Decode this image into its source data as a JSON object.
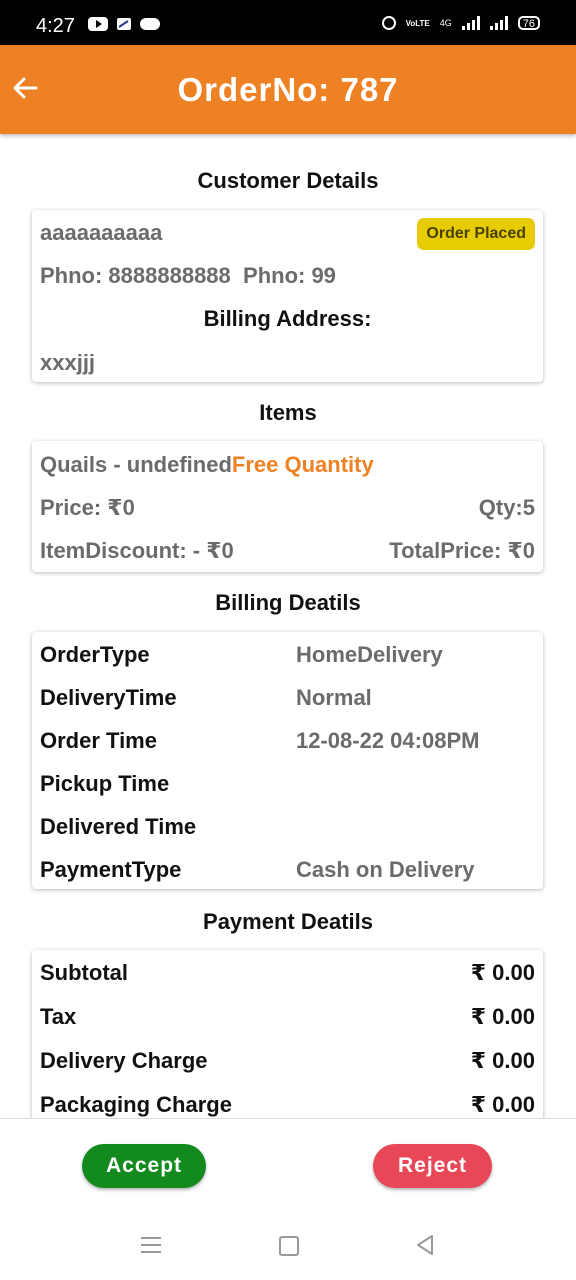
{
  "status_bar": {
    "time": "4:27",
    "battery": "76",
    "network": "4G",
    "volte": "VoLTE"
  },
  "app_bar": {
    "title": "OrderNo: 787"
  },
  "customer": {
    "section_title": "Customer Details",
    "name": "aaaaaaaaaa",
    "status": "Order Placed",
    "phone1": "Phno: 8888888888",
    "phone2": "Phno: 99",
    "billing_label": "Billing Address:",
    "address": "xxxjjj"
  },
  "items": {
    "section_title": "Items",
    "list": [
      {
        "name": "Quails - undefined",
        "tag": "Free Quantity",
        "price": "Price: ₹0",
        "qty": "Qty:5",
        "discount": "ItemDiscount: - ₹0",
        "total": "TotalPrice: ₹0"
      }
    ]
  },
  "billing": {
    "section_title": "Billing Deatils",
    "rows": [
      {
        "label": "OrderType",
        "value": "HomeDelivery"
      },
      {
        "label": "DeliveryTime",
        "value": "Normal"
      },
      {
        "label": "Order Time",
        "value": "12-08-22 04:08PM"
      },
      {
        "label": "Pickup Time",
        "value": ""
      },
      {
        "label": "Delivered Time",
        "value": ""
      },
      {
        "label": "PaymentType",
        "value": "Cash on Delivery"
      }
    ]
  },
  "payment": {
    "section_title": "Payment Deatils",
    "rows": [
      {
        "label": "Subtotal",
        "value": "₹ 0.00"
      },
      {
        "label": "Tax",
        "value": "₹ 0.00"
      },
      {
        "label": "Delivery Charge",
        "value": "₹ 0.00"
      },
      {
        "label": "Packaging Charge",
        "value": "₹ 0.00"
      }
    ]
  },
  "actions": {
    "accept": "Accept",
    "reject": "Reject"
  },
  "colors": {
    "primary": "#ee8124",
    "accept": "#138a1e",
    "reject": "#e84757",
    "badge": "#e6cc00"
  }
}
